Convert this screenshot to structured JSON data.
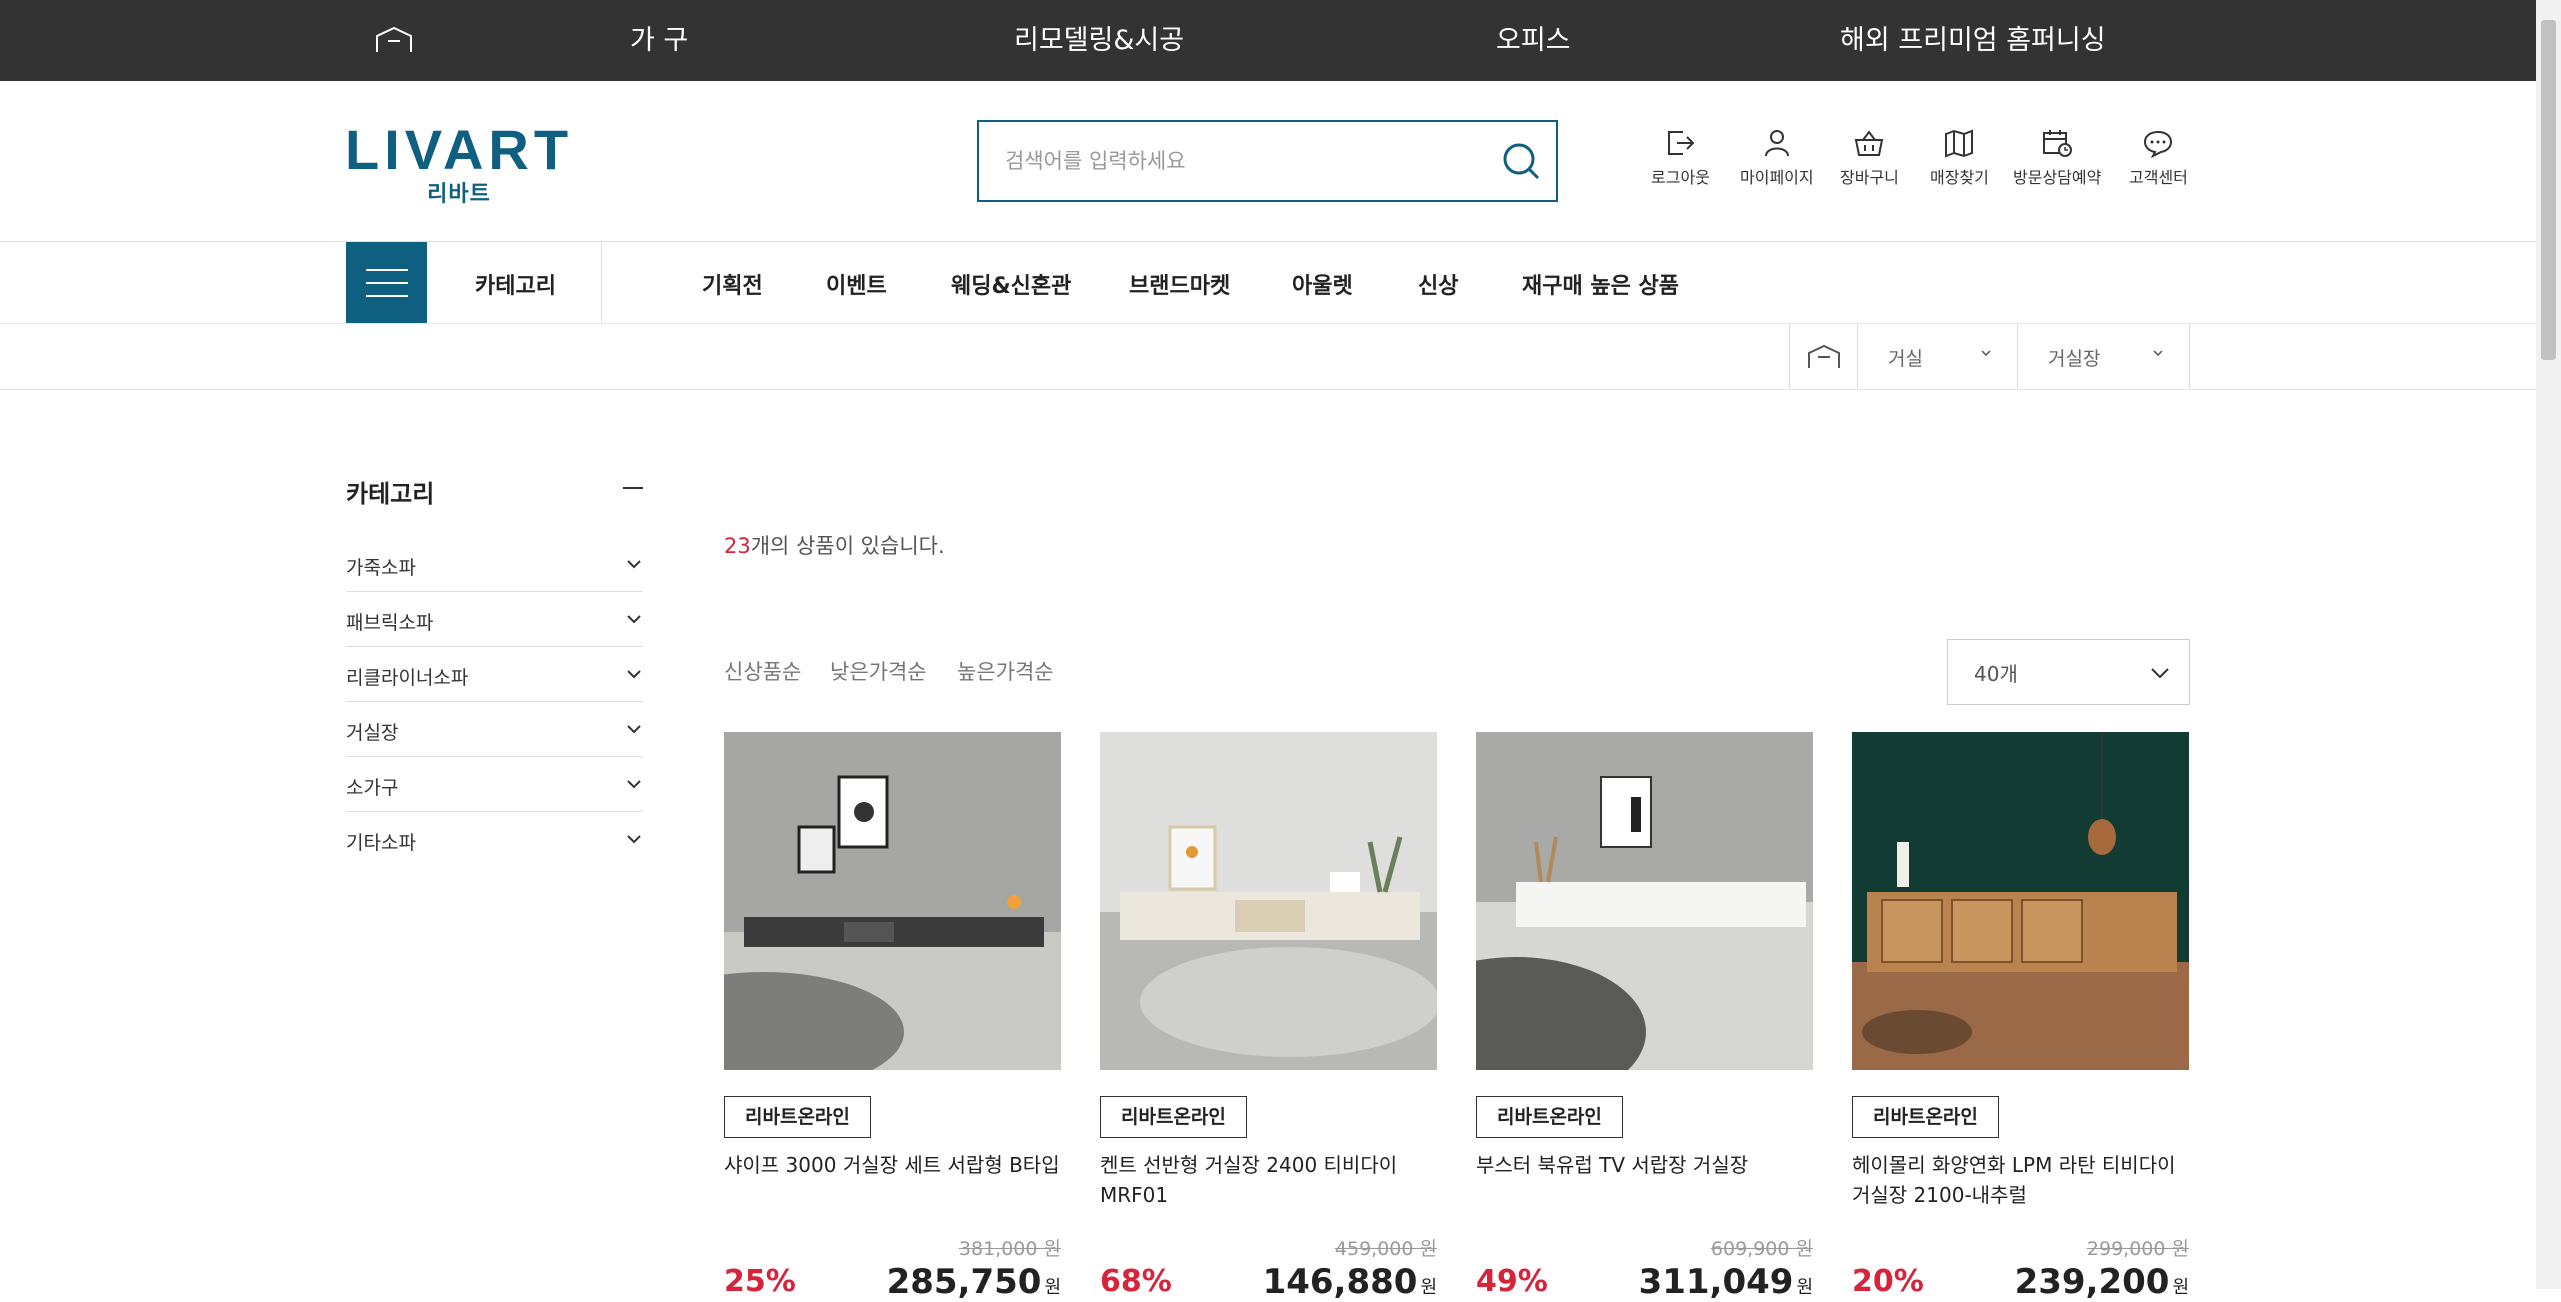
{
  "topbar": {
    "home_icon": "home-icon",
    "items": [
      "가 구",
      "리모델링&시공",
      "오피스",
      "해외 프리미엄 홈퍼니싱"
    ]
  },
  "logo": {
    "word": "LIVART",
    "sub": "리바트"
  },
  "search": {
    "placeholder": "검색어를 입력하세요",
    "icon": "search-icon"
  },
  "utility": [
    {
      "label": "로그아웃",
      "icon": "logout-icon"
    },
    {
      "label": "마이페이지",
      "icon": "user-icon"
    },
    {
      "label": "장바구니",
      "icon": "basket-icon"
    },
    {
      "label": "매장찾기",
      "icon": "map-icon"
    },
    {
      "label": "방문상담예약",
      "icon": "calendar-clock-icon"
    },
    {
      "label": "고객센터",
      "icon": "chat-bubble-icon"
    }
  ],
  "nav": {
    "category_label": "카테고리",
    "items": [
      "기획전",
      "이벤트",
      "웨딩&신혼관",
      "브랜드마켓",
      "아울렛",
      "신상",
      "재구매 높은 상품"
    ]
  },
  "breadcrumb": {
    "level1": "거실",
    "level2": "거실장"
  },
  "sidebar": {
    "title": "카테고리",
    "items": [
      "가죽소파",
      "패브릭소파",
      "리클라이너소파",
      "거실장",
      "소가구",
      "기타소파"
    ]
  },
  "listing": {
    "count": "23",
    "count_suffix": "개의 상품이 있습니다.",
    "sort_options": [
      "신상품순",
      "낮은가격순",
      "높은가격순"
    ],
    "per_page": "40개"
  },
  "products": [
    {
      "badge": "리바트온라인",
      "name": "샤이프 3000 거실장 세트 서랍형 B타입",
      "original": "381,000 원",
      "discount": "25%",
      "price": "285,750",
      "currency": "원"
    },
    {
      "badge": "리바트온라인",
      "name": "켄트 선반형 거실장 2400 티비다이 MRF01",
      "original": "459,000 원",
      "discount": "68%",
      "price": "146,880",
      "currency": "원"
    },
    {
      "badge": "리바트온라인",
      "name": "부스터 북유럽 TV 서랍장 거실장",
      "original": "609,900 원",
      "discount": "49%",
      "price": "311,049",
      "currency": "원"
    },
    {
      "badge": "리바트온라인",
      "name": "헤이몰리 화양연화 LPM 라탄 티비다이 거실장 2100-내추럴",
      "original": "299,000 원",
      "discount": "20%",
      "price": "239,200",
      "currency": "원"
    }
  ],
  "colors": {
    "brand": "#0f5f80",
    "topbar": "#333333",
    "sale": "#d6243a"
  }
}
